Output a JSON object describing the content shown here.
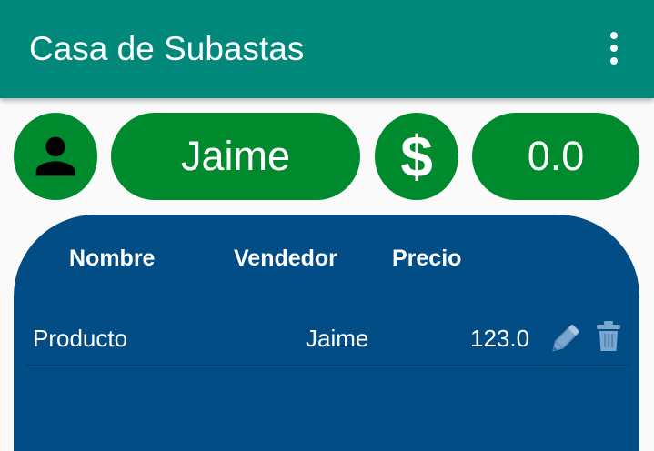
{
  "app_bar": {
    "title": "Casa de Subastas",
    "overflow_icon": "more-vert-icon"
  },
  "user": {
    "avatar_icon": "person-icon",
    "name": "Jaime",
    "currency_symbol": "$",
    "balance": "0.0"
  },
  "table": {
    "headers": {
      "name": "Nombre",
      "seller": "Vendedor",
      "price": "Precio"
    },
    "rows": [
      {
        "name": "Producto",
        "seller": "Jaime",
        "price": "123.0",
        "edit_icon": "pencil-icon",
        "delete_icon": "trash-icon"
      }
    ]
  },
  "colors": {
    "app_bar": "#00897b",
    "pill_green": "#008a2e",
    "panel_blue": "#034d87",
    "icon_blue": "#7ba7cf"
  }
}
